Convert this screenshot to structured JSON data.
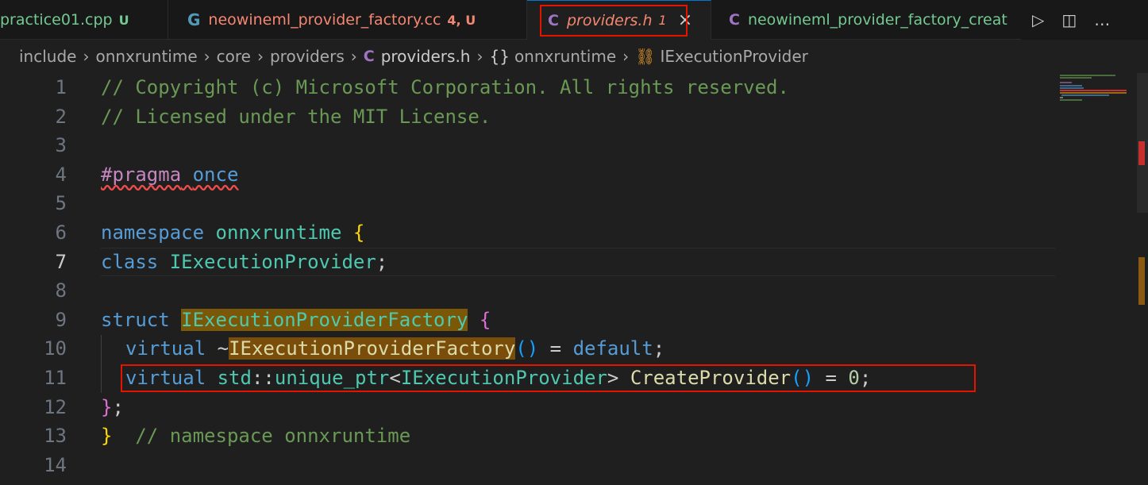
{
  "tabs": [
    {
      "name": "practice01.cpp",
      "badge": "U",
      "color": "#73c991",
      "badge_color": "#73c991",
      "icon": ""
    },
    {
      "name": "neowineml_provider_factory.cc",
      "badge": "4, U",
      "color": "#f48771",
      "badge_color": "#f48771",
      "icon": "C"
    },
    {
      "name": "providers.h",
      "badge": "1",
      "color": "#f48771",
      "badge_color": "#f48771",
      "icon": "C",
      "active": true,
      "close": "×"
    },
    {
      "name": "neowineml_provider_factory_creat",
      "badge": "",
      "color": "#73c991",
      "icon": "C"
    }
  ],
  "tab_actions": {
    "run_icon": "▷",
    "split_icon": "◫",
    "more_icon": "…"
  },
  "breadcrumb": {
    "items": [
      "include",
      "onnxruntime",
      "core",
      "providers",
      "providers.h",
      "onnxruntime",
      "IExecutionProvider"
    ],
    "separator": "›",
    "file_icon": "C",
    "namespace_icon": "{}",
    "class_icon": "⛓"
  },
  "editor": {
    "current_line": 7,
    "line_numbers": [
      "1",
      "2",
      "3",
      "4",
      "5",
      "6",
      "7",
      "8",
      "9",
      "10",
      "11",
      "12",
      "13",
      "14"
    ],
    "lines": {
      "l1": "// Copyright (c) Microsoft Corporation. All rights reserved.",
      "l2": "// Licensed under the MIT License.",
      "l4_pragma": "#pragma",
      "l4_once": "once",
      "l6_ns": "namespace",
      "l6_name": "onnxruntime",
      "l6_brace": "{",
      "l7_class": "class",
      "l7_name": "IExecutionProvider",
      "l7_semi": ";",
      "l9_struct": "struct",
      "l9_name": "IExecutionProviderFactory",
      "l9_brace": "{",
      "l10_virtual": "virtual",
      "l10_tilde": "~",
      "l10_name": "IExecutionProviderFactory",
      "l10_parens": "()",
      "l10_eq": " = ",
      "l10_default": "default",
      "l10_semi": ";",
      "l11_virtual": "virtual",
      "l11_std": "std",
      "l11_colons": "::",
      "l11_uptr": "unique_ptr",
      "l11_lt": "<",
      "l11_iep": "IExecutionProvider",
      "l11_gt": ">",
      "l11_fn": "CreateProvider",
      "l11_parens": "()",
      "l11_eq": " = ",
      "l11_zero": "0",
      "l11_semi": ";",
      "l12_close": "}",
      "l12_semi": ";",
      "l13_close": "}",
      "l13_comment": "// namespace onnxruntime"
    }
  },
  "colors": {
    "highlight_box": "#e51400",
    "comment": "#6a9955",
    "keyword": "#569cd6",
    "type": "#4ec9b0",
    "function": "#dcdcaa",
    "preprocessor": "#c586c0"
  }
}
